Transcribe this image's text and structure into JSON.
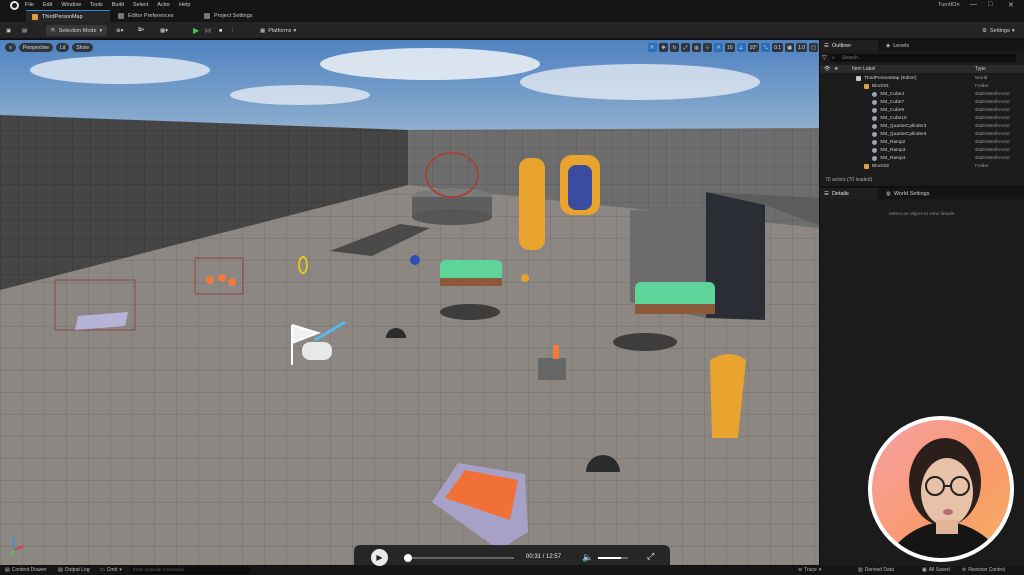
{
  "app": {
    "menu": [
      "File",
      "Edit",
      "Window",
      "Tools",
      "Build",
      "Select",
      "Actor",
      "Help"
    ],
    "project_name": "TurnItOn",
    "window_controls": [
      "—",
      "□",
      "✕"
    ]
  },
  "tabs": [
    {
      "label": "ThirdPersonMap",
      "active": true
    },
    {
      "label": "Editor Preferences",
      "active": false
    },
    {
      "label": "Project Settings",
      "active": false
    }
  ],
  "toolbar": {
    "selection_mode": "Selection Mode",
    "platforms": "Platforms",
    "settings": "Settings"
  },
  "viewport": {
    "perspective": "Perspective",
    "lit": "Lit",
    "show": "Show",
    "grid_snap": "10",
    "rotation_snap": "10°",
    "scale_snap": "0.1",
    "camera_speed": "1.0"
  },
  "video": {
    "current": "00:31",
    "total": "12:57",
    "progress": 0.04,
    "volume": 0.75
  },
  "outliner": {
    "tab_label": "Outliner",
    "levels_label": "Levels",
    "search_placeholder": "Search...",
    "col_label": "Item Label",
    "col_type": "Type",
    "rows": [
      {
        "label": "ThirdPersonMap (Editor)",
        "type": "World",
        "indent": 0,
        "kind": "world"
      },
      {
        "label": "Block01",
        "type": "Folder",
        "indent": 1,
        "kind": "folder"
      },
      {
        "label": "SM_Cube4",
        "type": "StaticMeshActor",
        "indent": 2,
        "kind": "mesh"
      },
      {
        "label": "SM_Cube7",
        "type": "StaticMeshActor",
        "indent": 2,
        "kind": "mesh"
      },
      {
        "label": "SM_Cube9",
        "type": "StaticMeshActor",
        "indent": 2,
        "kind": "mesh"
      },
      {
        "label": "SM_Cube10",
        "type": "StaticMeshActor",
        "indent": 2,
        "kind": "mesh"
      },
      {
        "label": "SM_QuarterCylinder3",
        "type": "StaticMeshActor",
        "indent": 2,
        "kind": "mesh"
      },
      {
        "label": "SM_QuarterCylinder6",
        "type": "StaticMeshActor",
        "indent": 2,
        "kind": "mesh"
      },
      {
        "label": "SM_Ramp2",
        "type": "StaticMeshActor",
        "indent": 2,
        "kind": "mesh"
      },
      {
        "label": "SM_Ramp3",
        "type": "StaticMeshActor",
        "indent": 2,
        "kind": "mesh"
      },
      {
        "label": "SM_Ramp4",
        "type": "StaticMeshActor",
        "indent": 2,
        "kind": "mesh"
      },
      {
        "label": "Block02",
        "type": "Folder",
        "indent": 1,
        "kind": "folder"
      }
    ],
    "footer": "70 actors (70 loaded)"
  },
  "details": {
    "tab_label": "Details",
    "world_settings_label": "World Settings",
    "empty_message": "Select an object to view details."
  },
  "statusbar": {
    "content_drawer": "Content Drawer",
    "output_log": "Output Log",
    "cmd": "Cmd",
    "console_placeholder": "Enter Console Command",
    "trace": "Trace",
    "derived_data": "Derived Data",
    "all_saved": "All Saved",
    "revision_control": "Revision Control"
  },
  "colors": {
    "accent": "#2b8ed8",
    "play_green": "#4bc24b",
    "floor": "#8c8782",
    "wall": "#464646",
    "sky": "#5f8ec7",
    "arch_yellow": "#e8a42e",
    "platform_green": "#5ed39a",
    "button_orange": "#f07038"
  }
}
